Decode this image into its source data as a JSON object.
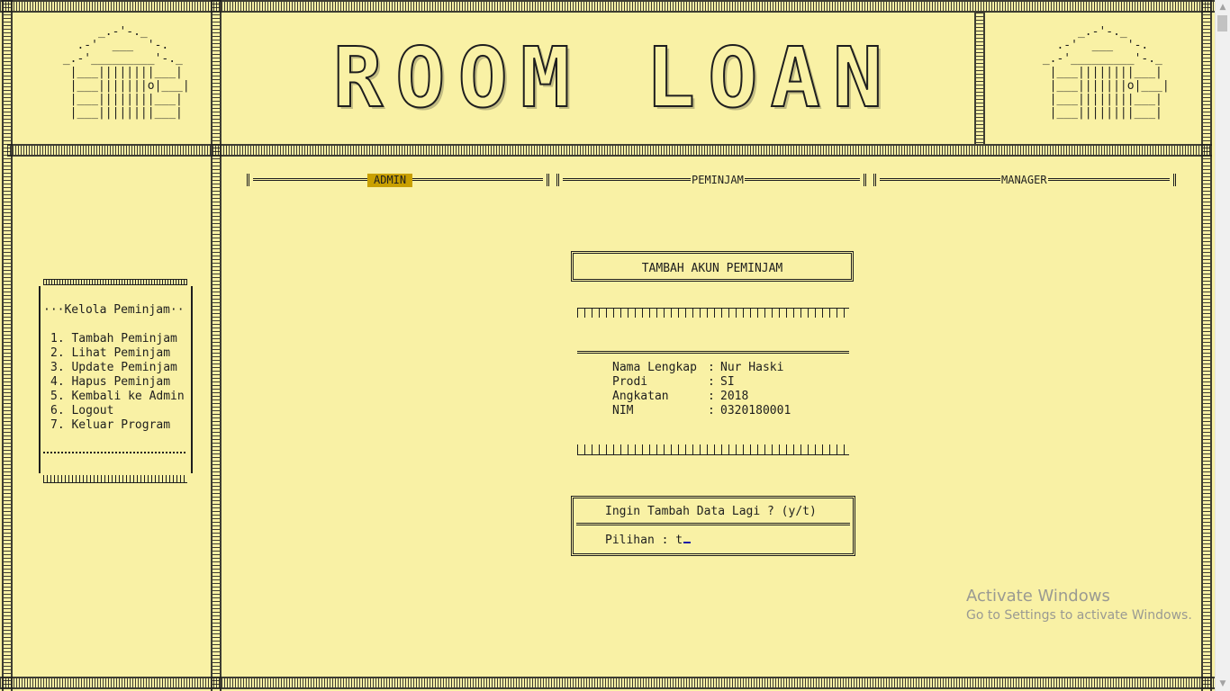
{
  "banner": {
    "title": "ROOM LOAN",
    "house_art": "      _.-'-._\n   .-'  ___  '-.\n _.-'_________'-._\n  |___||||||||___|\n  |___|||||||o|___|\n  |___||||||||___|\n  |___||||||||___|"
  },
  "tabs": [
    {
      "label": "ADMIN",
      "active": true
    },
    {
      "label": "PEMINJAM",
      "active": false
    },
    {
      "label": "MANAGER",
      "active": false
    }
  ],
  "menu": {
    "heading": "···Kelola Peminjam··",
    "items": [
      {
        "label": "1. Tambah Peminjam"
      },
      {
        "label": "2. Lihat Peminjam"
      },
      {
        "label": "3. Update Peminjam"
      },
      {
        "label": "4. Hapus Peminjam"
      },
      {
        "label": "5. Kembali ke Admin"
      },
      {
        "label": "6. Logout"
      },
      {
        "label": "7. Keluar Program"
      }
    ]
  },
  "form": {
    "title": "TAMBAH AKUN PEMINJAM",
    "fields": [
      {
        "label": "Nama Lengkap",
        "sep": ":",
        "value": "Nur Haski"
      },
      {
        "label": "Prodi",
        "sep": ":",
        "value": "SI"
      },
      {
        "label": "Angkatan",
        "sep": ":",
        "value": "2018"
      },
      {
        "label": "NIM",
        "sep": ":",
        "value": "0320180001"
      }
    ]
  },
  "confirm": {
    "question": "Ingin Tambah Data Lagi ? (y/t)",
    "prompt": "Pilihan : ",
    "input_value": "t"
  },
  "watermark": {
    "line1": "Activate Windows",
    "line2": "Go to Settings to activate Windows."
  },
  "colors": {
    "background": "#f9f1a5",
    "text": "#1e1e1e",
    "active_tab": "#c9a000",
    "cursor": "#1a1aa6"
  }
}
